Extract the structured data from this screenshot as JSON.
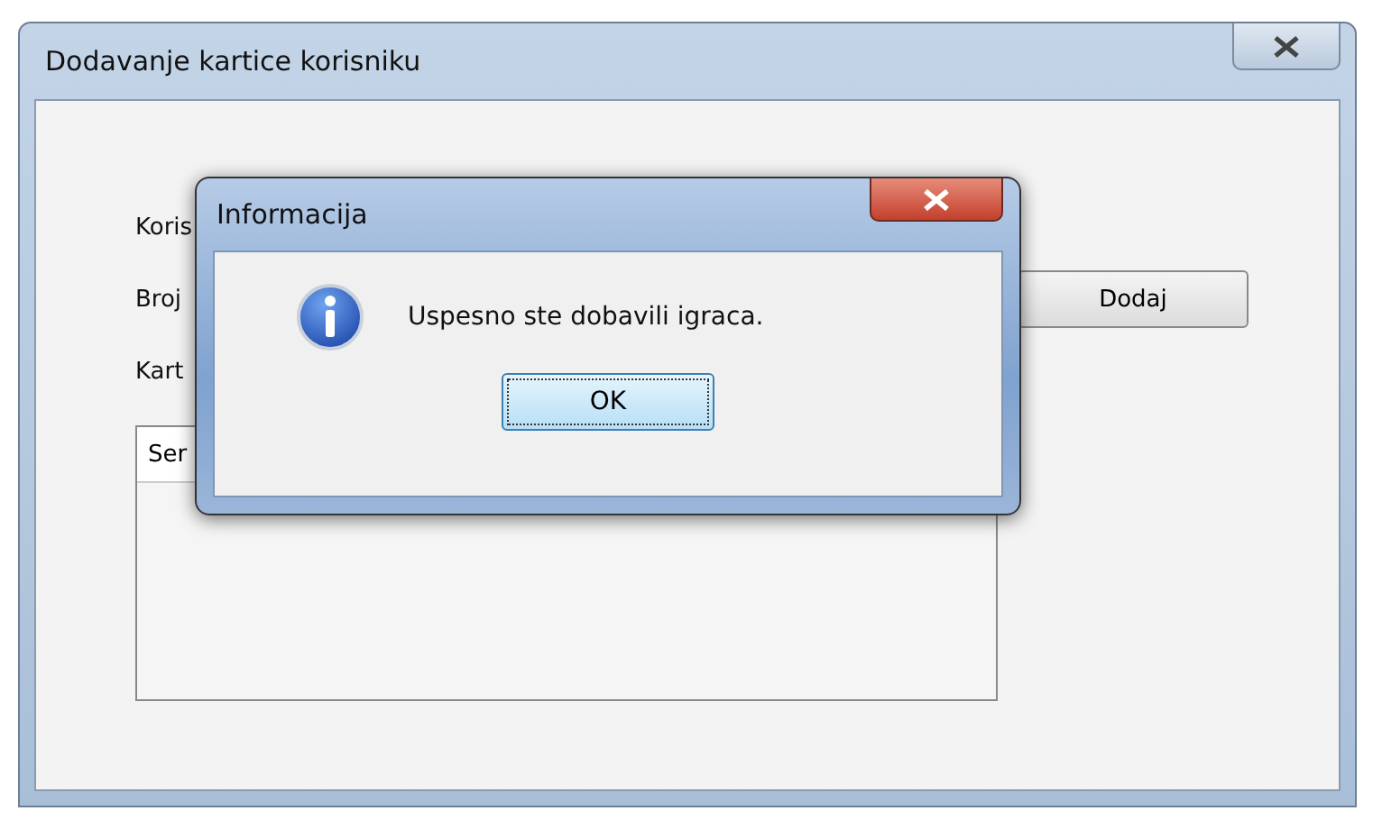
{
  "main_window": {
    "title": "Dodavanje kartice korisniku",
    "labels": [
      "Koris",
      "Broj",
      "Kart"
    ],
    "add_button": "Dodaj",
    "list": {
      "column_1": "Ser"
    }
  },
  "dialog": {
    "title": "Informacija",
    "message": "Uspesno ste dobavili igraca.",
    "ok_button": "OK"
  }
}
